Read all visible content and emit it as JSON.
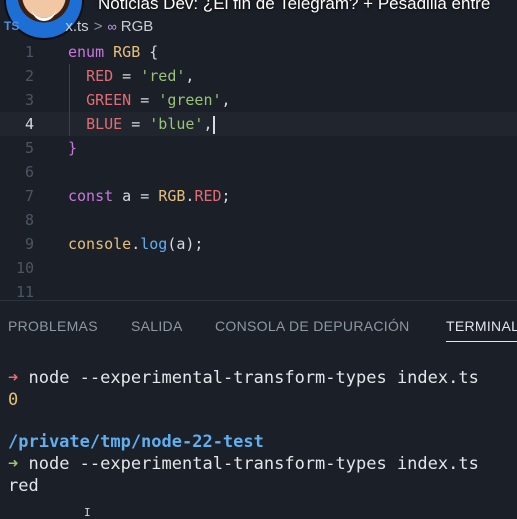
{
  "overlay": {
    "video_title": "Noticias Dev: ¿El fin de Telegram? + Pesadilla entre"
  },
  "breadcrumb": {
    "lang_badge": "TS",
    "file": "x.ts",
    "separator": ">",
    "symbol_icon": "∞",
    "symbol": "RGB"
  },
  "editor": {
    "line_numbers": [
      "1",
      "2",
      "3",
      "4",
      "5",
      "6",
      "7",
      "8",
      "9",
      "10",
      "11"
    ],
    "current_line": "4",
    "lines": {
      "l1": {
        "kw": "enum",
        "name": "RGB",
        "brace": " {"
      },
      "l2": {
        "prop": "RED",
        "eq": " = ",
        "str": "'red'",
        "comma": ","
      },
      "l3": {
        "prop": "GREEN",
        "eq": " = ",
        "str": "'green'",
        "comma": ","
      },
      "l4": {
        "prop": "BLUE",
        "eq": " = ",
        "str": "'blue'",
        "comma": ","
      },
      "l5": {
        "brace": "}"
      },
      "l7": {
        "kw": "const",
        "var": " a = ",
        "type": "RGB",
        "dot": ".",
        "prop": "RED",
        "semi": ";"
      },
      "l9": {
        "obj": "console",
        "dot": ".",
        "fn": "log",
        "args": "(a);"
      }
    }
  },
  "panel": {
    "tabs": [
      "PROBLEMAS",
      "SALIDA",
      "CONSOLA DE DEPURACIÓN",
      "TERMINAL"
    ],
    "active_tab": "TERMINAL"
  },
  "terminal": {
    "prompt_arrow": "➜",
    "cmd1": " node --experimental-transform-types index.ts",
    "out1": "0",
    "path": "/private/tmp/node-22-test",
    "cmd2": " node --experimental-transform-types index.ts",
    "out2": "red",
    "mouse_icon": "I"
  },
  "colors": {
    "background": "#1b1f27",
    "keyword": "#c678dd",
    "type": "#e5c07b",
    "string": "#98c379",
    "property": "#e06c75",
    "function": "#61afef"
  }
}
